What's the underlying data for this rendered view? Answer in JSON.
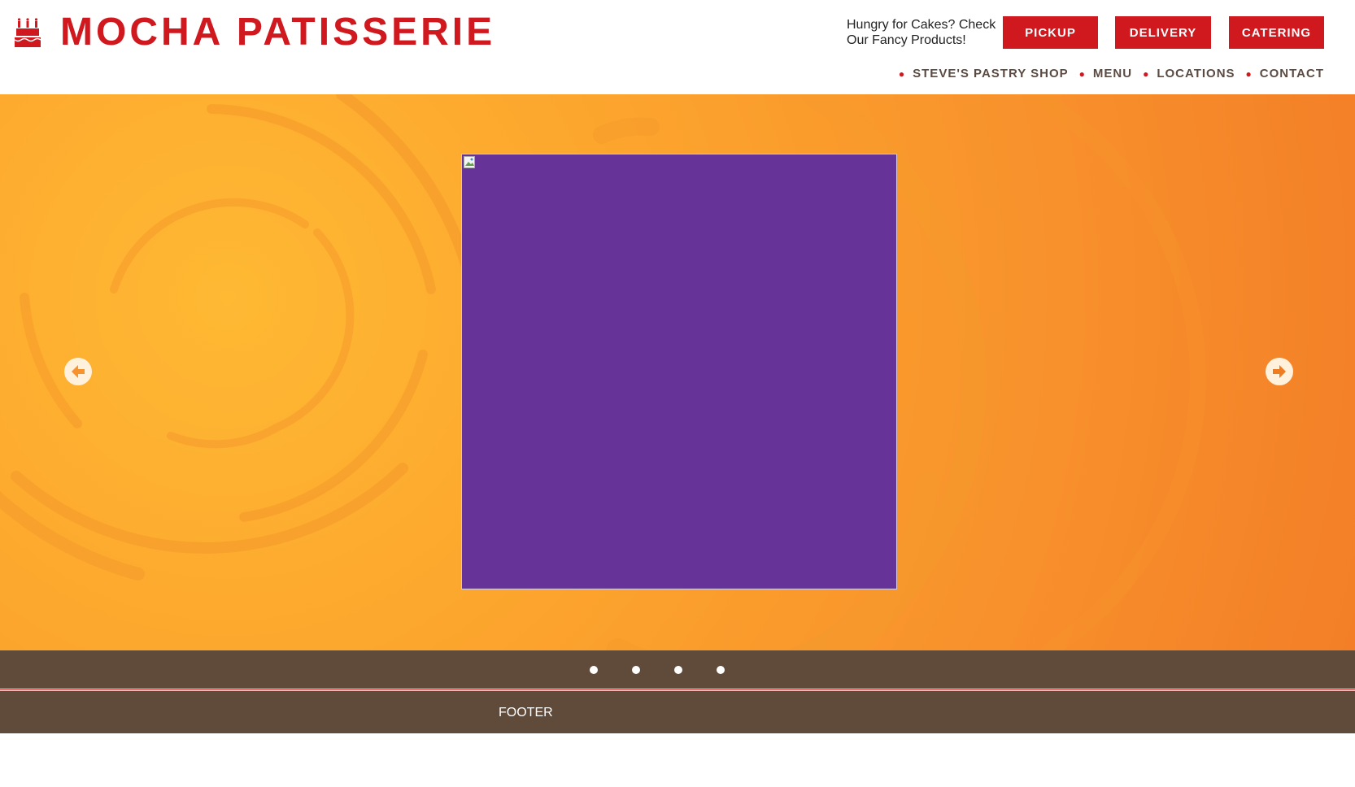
{
  "brand": {
    "name": "MOCHA PATISSERIE",
    "logo_icon": "cake-icon",
    "color": "#d0181f"
  },
  "header": {
    "tagline": "Hungry for Cakes? Check Our Fancy Products!",
    "buttons": {
      "pickup": "PICKUP",
      "delivery": "DELIVERY",
      "catering": "CATERING"
    }
  },
  "nav": {
    "items": [
      {
        "label": "STEVE'S PASTRY SHOP"
      },
      {
        "label": "MENU"
      },
      {
        "label": "LOCATIONS"
      },
      {
        "label": "CONTACT"
      }
    ]
  },
  "carousel": {
    "slide_image_color": "#663399",
    "prev_icon": "arrow-left-icon",
    "next_icon": "arrow-right-icon",
    "slide_count": 4
  },
  "footer": {
    "label": "FOOTER",
    "color": "#604a3a"
  }
}
